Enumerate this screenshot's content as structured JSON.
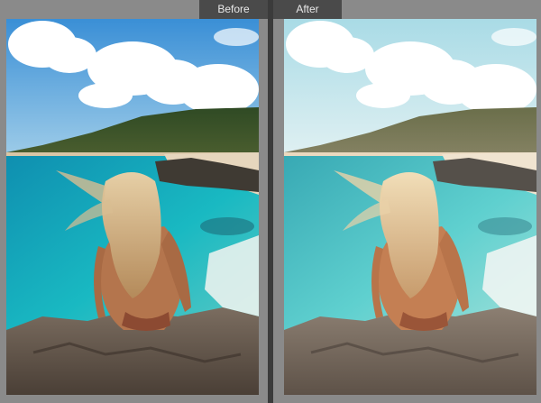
{
  "labels": {
    "before": "Before",
    "after": "After"
  },
  "colors": {
    "frame": "#8a8a8a",
    "tab": "#4a4a4a",
    "divider": "#3b3b3b"
  }
}
